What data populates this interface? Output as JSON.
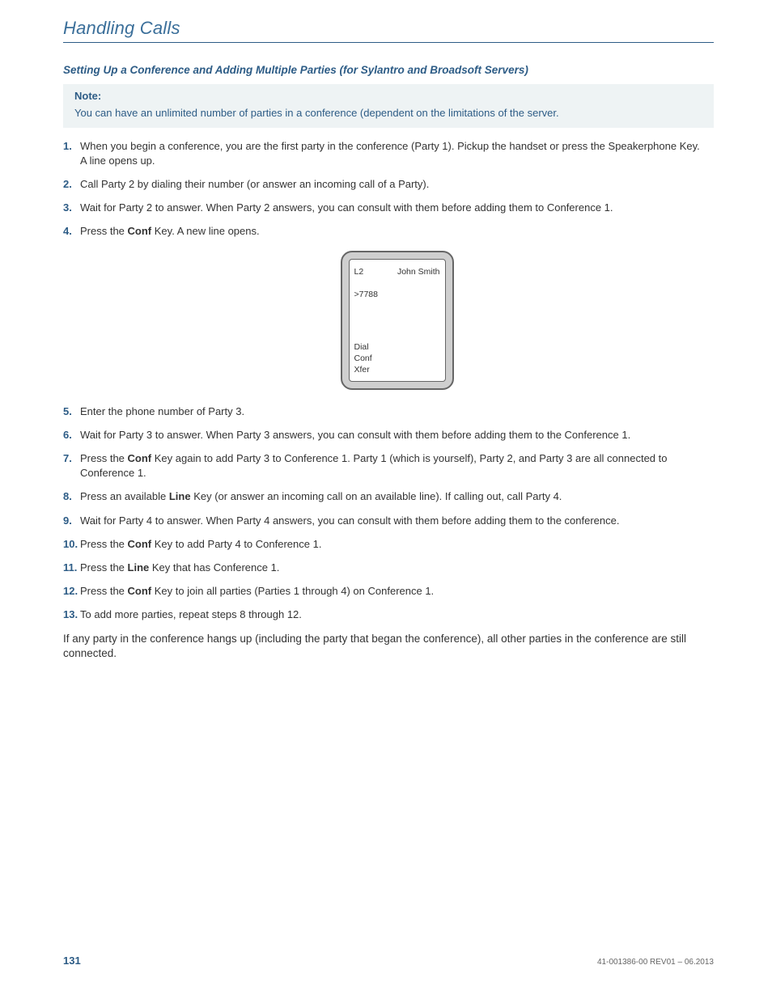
{
  "header": {
    "title": "Handling Calls"
  },
  "section_heading": "Setting Up a Conference and Adding Multiple Parties (for Sylantro and Broadsoft Servers)",
  "note": {
    "label": "Note:",
    "text": "You can have an unlimited number of parties in a conference (dependent on the limitations of the server."
  },
  "steps": [
    {
      "pre": "When you begin a conference, you are the first party in the conference (Party 1). Pickup the handset or press the Speakerphone Key.",
      "br": "A line opens up."
    },
    {
      "pre": "Call Party 2 by dialing their number (or answer an incoming call of a Party)."
    },
    {
      "pre": "Wait for Party 2 to answer. When Party 2 answers, you can consult with them before adding them to Conference 1."
    },
    {
      "pre": "Press the ",
      "bold": "Conf",
      "post": " Key. A new line opens."
    },
    {
      "pre": "Enter the phone number of Party 3."
    },
    {
      "pre": "Wait for Party 3 to answer. When Party 3 answers, you can consult with them before adding them to the Conference 1."
    },
    {
      "pre": "Press the ",
      "bold": "Conf",
      "post": " Key again to add Party 3 to Conference 1. Party 1 (which is yourself), Party 2, and Party 3 are all connected to Conference 1."
    },
    {
      "pre": "Press an available ",
      "bold": "Line",
      "post": " Key (or answer an incoming call on an available line). If calling out, call Party 4."
    },
    {
      "pre": "Wait for Party 4 to answer. When Party 4 answers, you can consult with them before adding them to the conference."
    },
    {
      "pre": "Press the ",
      "bold": "Conf",
      "post": " Key to add Party 4 to Conference 1."
    },
    {
      "pre": "Press the ",
      "bold": "Line",
      "post": " Key that has Conference 1."
    },
    {
      "pre": "Press the ",
      "bold": "Conf",
      "post": " Key to join all parties (Parties 1 through 4) on Conference 1."
    },
    {
      "pre": "To add more parties, repeat steps 8 through 12."
    }
  ],
  "phone": {
    "line": "L2",
    "name": "John Smith",
    "number": ">7788",
    "softkeys": [
      "Dial",
      "Conf",
      "Xfer"
    ]
  },
  "closing": "If any party in the conference hangs up (including the party that began the conference), all other parties in the conference are still connected.",
  "footer": {
    "page": "131",
    "docid": "41-001386-00 REV01 – 06.2013"
  }
}
